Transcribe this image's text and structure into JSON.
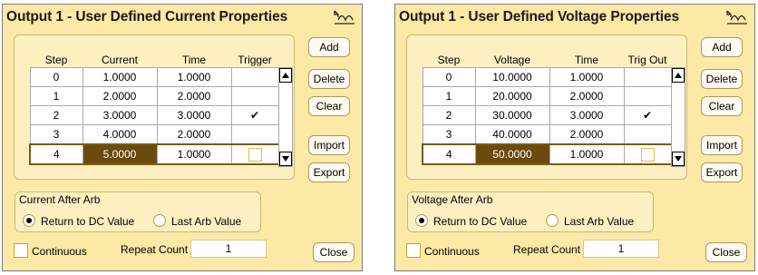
{
  "dialogs": [
    {
      "title": "Output 1 - User Defined Current Properties",
      "icon": "arb-waveform-icon",
      "columns": [
        "Step",
        "Current",
        "Time",
        "Trigger"
      ],
      "rows": [
        {
          "step": "0",
          "value": "1.0000",
          "time": "1.0000",
          "mark": ""
        },
        {
          "step": "1",
          "value": "2.0000",
          "time": "2.0000",
          "mark": ""
        },
        {
          "step": "2",
          "value": "3.0000",
          "time": "3.0000",
          "mark": "✔"
        },
        {
          "step": "3",
          "value": "4.0000",
          "time": "2.0000",
          "mark": ""
        },
        {
          "step": "4",
          "value": "5.0000",
          "time": "1.0000",
          "mark": ""
        }
      ],
      "selected_row": 4,
      "buttons": {
        "add": "Add",
        "delete": "Delete",
        "clear": "Clear",
        "import": "Import",
        "export": "Export",
        "close": "Close"
      },
      "after_arb": {
        "label": "Current After Arb",
        "option1": "Return to DC Value",
        "option2": "Last Arb Value",
        "selected": "option1"
      },
      "continuous_label": "Continuous",
      "continuous_checked": false,
      "repeat_label": "Repeat Count",
      "repeat_value": "1"
    },
    {
      "title": "Output 1 - User Defined Voltage Properties",
      "icon": "arb-waveform-icon",
      "columns": [
        "Step",
        "Voltage",
        "Time",
        "Trig Out"
      ],
      "rows": [
        {
          "step": "0",
          "value": "10.0000",
          "time": "1.0000",
          "mark": ""
        },
        {
          "step": "1",
          "value": "20.0000",
          "time": "2.0000",
          "mark": ""
        },
        {
          "step": "2",
          "value": "30.0000",
          "time": "3.0000",
          "mark": "✔"
        },
        {
          "step": "3",
          "value": "40.0000",
          "time": "2.0000",
          "mark": ""
        },
        {
          "step": "4",
          "value": "50.0000",
          "time": "1.0000",
          "mark": ""
        }
      ],
      "selected_row": 4,
      "buttons": {
        "add": "Add",
        "delete": "Delete",
        "clear": "Clear",
        "import": "Import",
        "export": "Export",
        "close": "Close"
      },
      "after_arb": {
        "label": "Voltage After Arb",
        "option1": "Return to DC Value",
        "option2": "Last Arb Value",
        "selected": "option1"
      },
      "continuous_label": "Continuous",
      "continuous_checked": false,
      "repeat_label": "Repeat Count",
      "repeat_value": "1"
    }
  ],
  "colors": {
    "dialog_bg": "#fce9a6",
    "selected_cell": "#6b4a10",
    "border_accent": "#c9b878"
  }
}
